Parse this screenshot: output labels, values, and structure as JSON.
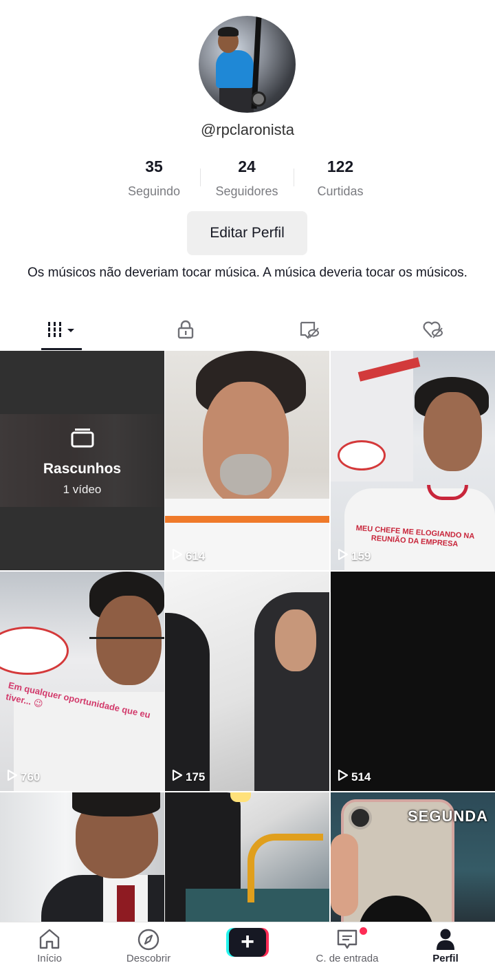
{
  "profile": {
    "username": "@rpclaronista",
    "bio": "Os músicos não deveriam tocar música. A música deveria tocar os músicos."
  },
  "stats": [
    {
      "value": "35",
      "label": "Seguindo"
    },
    {
      "value": "24",
      "label": "Seguidores"
    },
    {
      "value": "122",
      "label": "Curtidas"
    }
  ],
  "edit_button": "Editar Perfil",
  "tabs": [
    {
      "icon": "videos-grid-icon",
      "active": true
    },
    {
      "icon": "lock-icon",
      "active": false
    },
    {
      "icon": "tagged-hidden-icon",
      "active": false
    },
    {
      "icon": "liked-hidden-icon",
      "active": false
    }
  ],
  "drafts": {
    "title": "Rascunhos",
    "count": "1 vídeo"
  },
  "videos": [
    {
      "views": "614"
    },
    {
      "views": "159",
      "caption": "MEU CHEFE ME ELOGIANDO NA REUNIÃO DA EMPRESA"
    },
    {
      "views": "760",
      "caption": "Em qualquer oportunidade que eu tiver... 😉"
    },
    {
      "views": "175"
    },
    {
      "views": "514"
    },
    {
      "views": ""
    },
    {
      "views": ""
    },
    {
      "views": "",
      "caption": "SEGUNDA"
    }
  ],
  "bottom_nav": [
    {
      "label": "Início",
      "icon": "home-icon"
    },
    {
      "label": "Descobrir",
      "icon": "compass-icon"
    },
    {
      "label": "",
      "icon": "plus-icon"
    },
    {
      "label": "C. de entrada",
      "icon": "inbox-icon"
    },
    {
      "label": "Perfil",
      "icon": "profile-icon",
      "active": true
    }
  ],
  "colors": {
    "accent": "#fe2c55",
    "cyan": "#25f4ee",
    "text": "#161823",
    "muted": "#7a7b80"
  }
}
